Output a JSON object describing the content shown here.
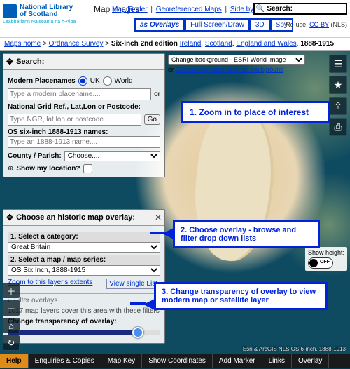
{
  "header": {
    "org_line1": "National Library",
    "org_line2": "of Scotland",
    "org_sub": "Leabharlann Nàiseanta na h-Alba",
    "section": "Map images",
    "links": {
      "finder": "Map Finder",
      "georef": "Georeferenced Maps",
      "side": "Side by Side"
    },
    "tabs": {
      "overlays": "as Overlays",
      "full": "Full Screen/Draw",
      "three_d": "3D",
      "spy": "Spy"
    },
    "search_label": "Search:",
    "reuse_prefix": "Re-use:",
    "reuse_link": "CC-BY",
    "reuse_suffix": "(NLS)"
  },
  "crumbs": {
    "home": "Maps home",
    "os": "Ordnance Survey",
    "label": "Six-inch 2nd edition",
    "ir": "Ireland",
    "sc": "Scotland",
    "ew": "England and Wales",
    "years": "1888-1915"
  },
  "search_panel": {
    "title": "Search:",
    "modern_label": "Modern Placenames",
    "uk": "UK",
    "world": "World",
    "modern_ph": "Type a modern placename....",
    "or": "or",
    "ngr_label": "National Grid Ref., Lat,Lon or Postcode:",
    "ngr_ph": "Type NGR, lat,lon or postcode....",
    "go": "Go",
    "os_label": "OS six-inch 1888-1913 names:",
    "os_ph": "Type an 1888-1913 name....",
    "county_label": "County / Parish:",
    "county_sel": "Choose....",
    "loc_label": "Show my location?"
  },
  "bg": {
    "select": "Change background - ESRI World Image",
    "or": "or ",
    "link": "Choose any other layer as background"
  },
  "overlay_panel": {
    "title": "Choose an historic map overlay:",
    "cat_label": "1. Select a category:",
    "cat_sel": "Great Britain",
    "map_label": "2. Select a map / map series:",
    "map_sel": "OS Six Inch, 1888-1915",
    "zoom_link": "Zoom to this layer's extents",
    "view_list": "View single List",
    "filter_label": "Filter overlays",
    "count": "1017 map layers cover this area with these filters",
    "trans_label": "Change transparency of overlay:"
  },
  "right": {
    "show_height": "Show height:",
    "off": "OFF"
  },
  "copyright": "Esri & ArcGIS    NLS OS 6-inch, 1888-1913",
  "annotations": {
    "a1": "1.   Zoom in to place of interest",
    "a2": "2. Choose overlay - browse and filter drop down lists",
    "a3": "3. Change transparency of overlay to view modern map or satellite layer"
  },
  "footer": {
    "help": "Help",
    "enq": "Enquiries & Copies",
    "key": "Map Key",
    "coords": "Show Coordinates",
    "marker": "Add Marker",
    "links": "Links",
    "overlay": "Overlay"
  }
}
